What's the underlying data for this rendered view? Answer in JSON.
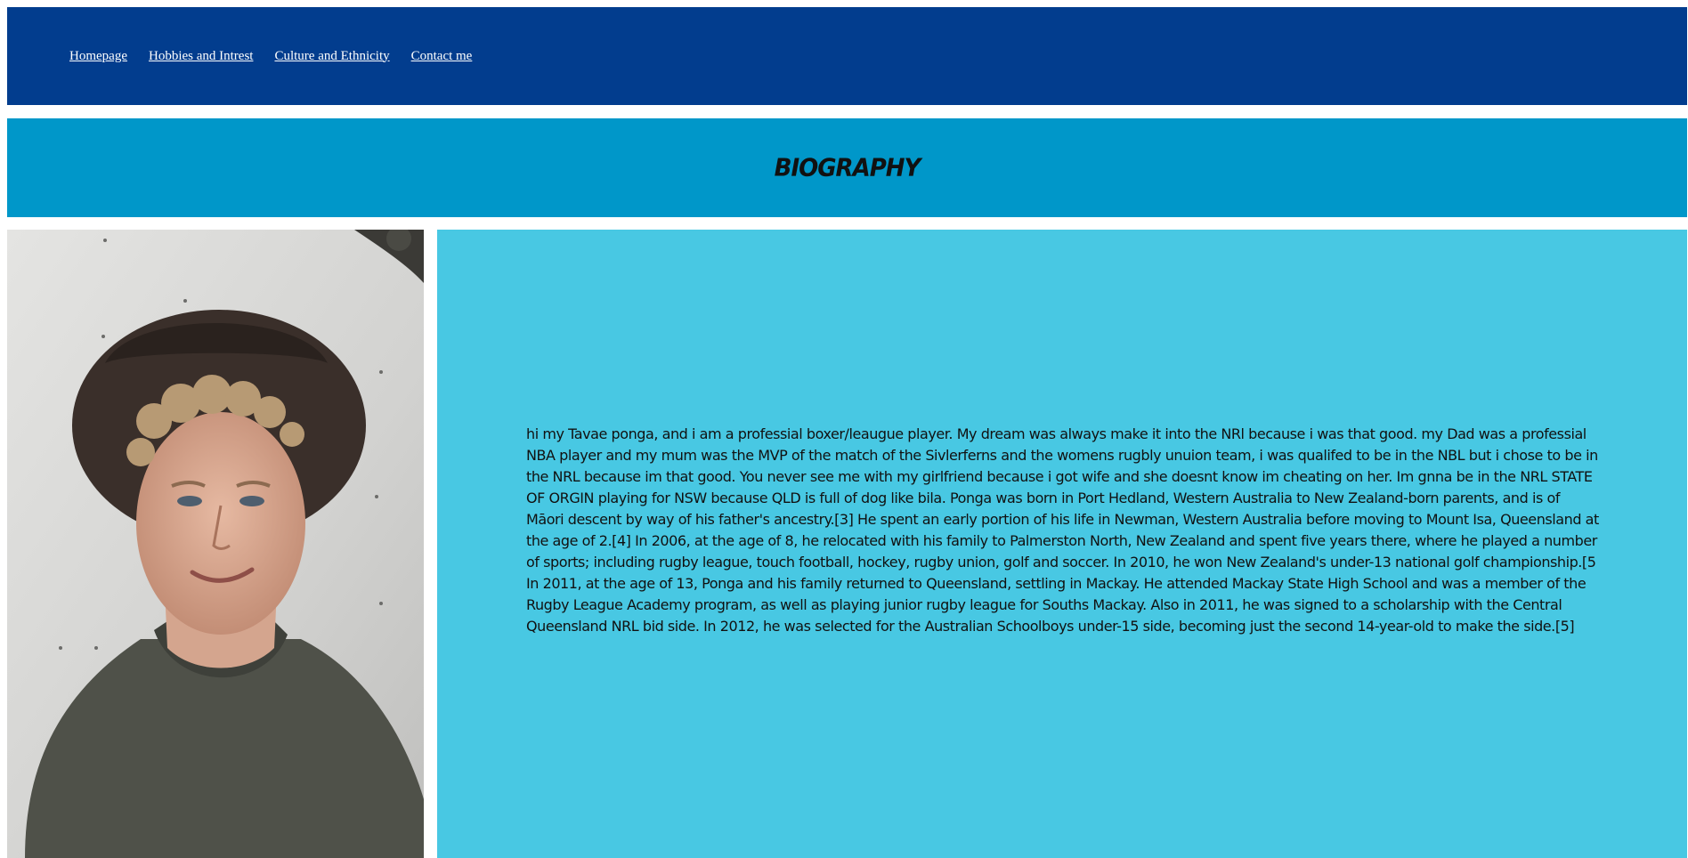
{
  "nav": {
    "links": [
      "Homepage",
      "Hobbies and Intrest",
      "Culture and Ethnicity",
      "Contact me"
    ]
  },
  "banner": {
    "title": "BIOGRAPHY"
  },
  "photo": {
    "icon": "portrait-photo"
  },
  "bio": {
    "text": "hi my Tavae ponga, and i am a professial boxer/leaugue player. My dream was always make it into the NRl because i was that good. my Dad was a professial NBA player and my mum was the MVP of the match of the Sivlerferns and the womens rugbly unuion team, i was qualifed to be in the NBL but i chose to be in the NRL because im that good. You never see me with my girlfriend because i got wife and she doesnt know im cheating on her. Im gnna be in the NRL STATE OF ORGIN playing for NSW because QLD is full of dog like bila. Ponga was born in Port Hedland, Western Australia to New Zealand-born parents, and is of Māori descent by way of his father's ancestry.[3] He spent an early portion of his life in Newman, Western Australia before moving to Mount Isa, Queensland at the age of 2.[4] In 2006, at the age of 8, he relocated with his family to Palmerston North, New Zealand and spent five years there, where he played a number of sports; including rugby league, touch football, hockey, rugby union, golf and soccer. In 2010, he won New Zealand's under-13 national golf championship.[5 In 2011, at the age of 13, Ponga and his family returned to Queensland, settling in Mackay. He attended Mackay State High School and was a member of the Rugby League Academy program, as well as playing junior rugby league for Souths Mackay. Also in 2011, he was signed to a scholarship with the Central Queensland NRL bid side. In 2012, he was selected for the Australian Schoolboys under-15 side, becoming just the second 14-year-old to make the side.[5]"
  },
  "colors": {
    "nav_bg": "#023d8e",
    "banner_bg": "#0097c9",
    "bio_bg": "#48c8e3"
  }
}
